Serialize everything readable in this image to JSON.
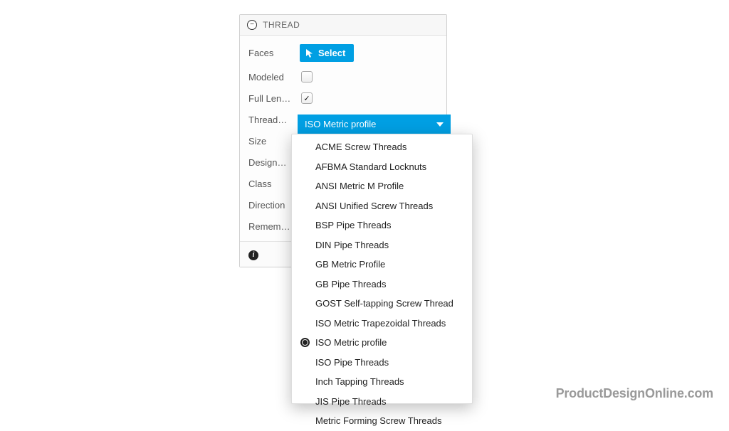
{
  "panel": {
    "title": "THREAD",
    "collapse_glyph": "−"
  },
  "rows": {
    "faces": {
      "label": "Faces",
      "button": "Select"
    },
    "modeled": {
      "label": "Modeled",
      "checked": false
    },
    "full_length": {
      "label": "Full Len…",
      "checked": true
    },
    "thread_type": {
      "label": "Thread…",
      "selected": "ISO Metric profile"
    },
    "size": {
      "label": "Size"
    },
    "designation": {
      "label": "Design…"
    },
    "class": {
      "label": "Class"
    },
    "direction": {
      "label": "Direction"
    },
    "remember": {
      "label": "Remem…"
    }
  },
  "dropdown": {
    "options": [
      "ACME Screw Threads",
      "AFBMA Standard Locknuts",
      "ANSI Metric M Profile",
      "ANSI Unified Screw Threads",
      "BSP Pipe Threads",
      "DIN Pipe Threads",
      "GB Metric Profile",
      "GB Pipe Threads",
      "GOST Self-tapping Screw Thread",
      "ISO Metric Trapezoidal Threads",
      "ISO Metric profile",
      "ISO Pipe Threads",
      "Inch Tapping Threads",
      "JIS Pipe Threads",
      "Metric Forming Screw Threads"
    ],
    "selected_index": 10
  },
  "watermark": "ProductDesignOnline.com"
}
